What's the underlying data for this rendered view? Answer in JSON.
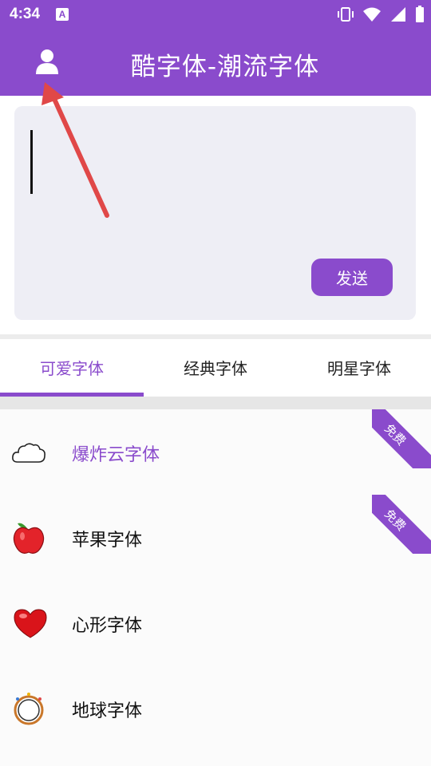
{
  "status_bar": {
    "time": "4:34",
    "notification_icon": "a-icon",
    "right_icons": [
      "vibrate-icon",
      "wifi-icon",
      "signal-icon",
      "battery-icon"
    ]
  },
  "app_bar": {
    "title": "酷字体-潮流字体",
    "user_icon": "user-icon"
  },
  "input": {
    "value": "",
    "send_label": "发送"
  },
  "tabs": [
    {
      "label": "可爱字体",
      "active": true
    },
    {
      "label": "经典字体",
      "active": false
    },
    {
      "label": "明星字体",
      "active": false
    }
  ],
  "fonts": [
    {
      "label": "爆炸云字体",
      "icon": "cloud-icon",
      "badge": "免费",
      "highlight": true
    },
    {
      "label": "苹果字体",
      "icon": "apple-icon",
      "badge": "免费",
      "highlight": false
    },
    {
      "label": "心形字体",
      "icon": "heart-icon",
      "badge": "",
      "highlight": false
    },
    {
      "label": "地球字体",
      "icon": "globe-icon",
      "badge": "",
      "highlight": false
    }
  ],
  "colors": {
    "accent": "#8a4bcc",
    "annotation_arrow": "#e04848"
  }
}
